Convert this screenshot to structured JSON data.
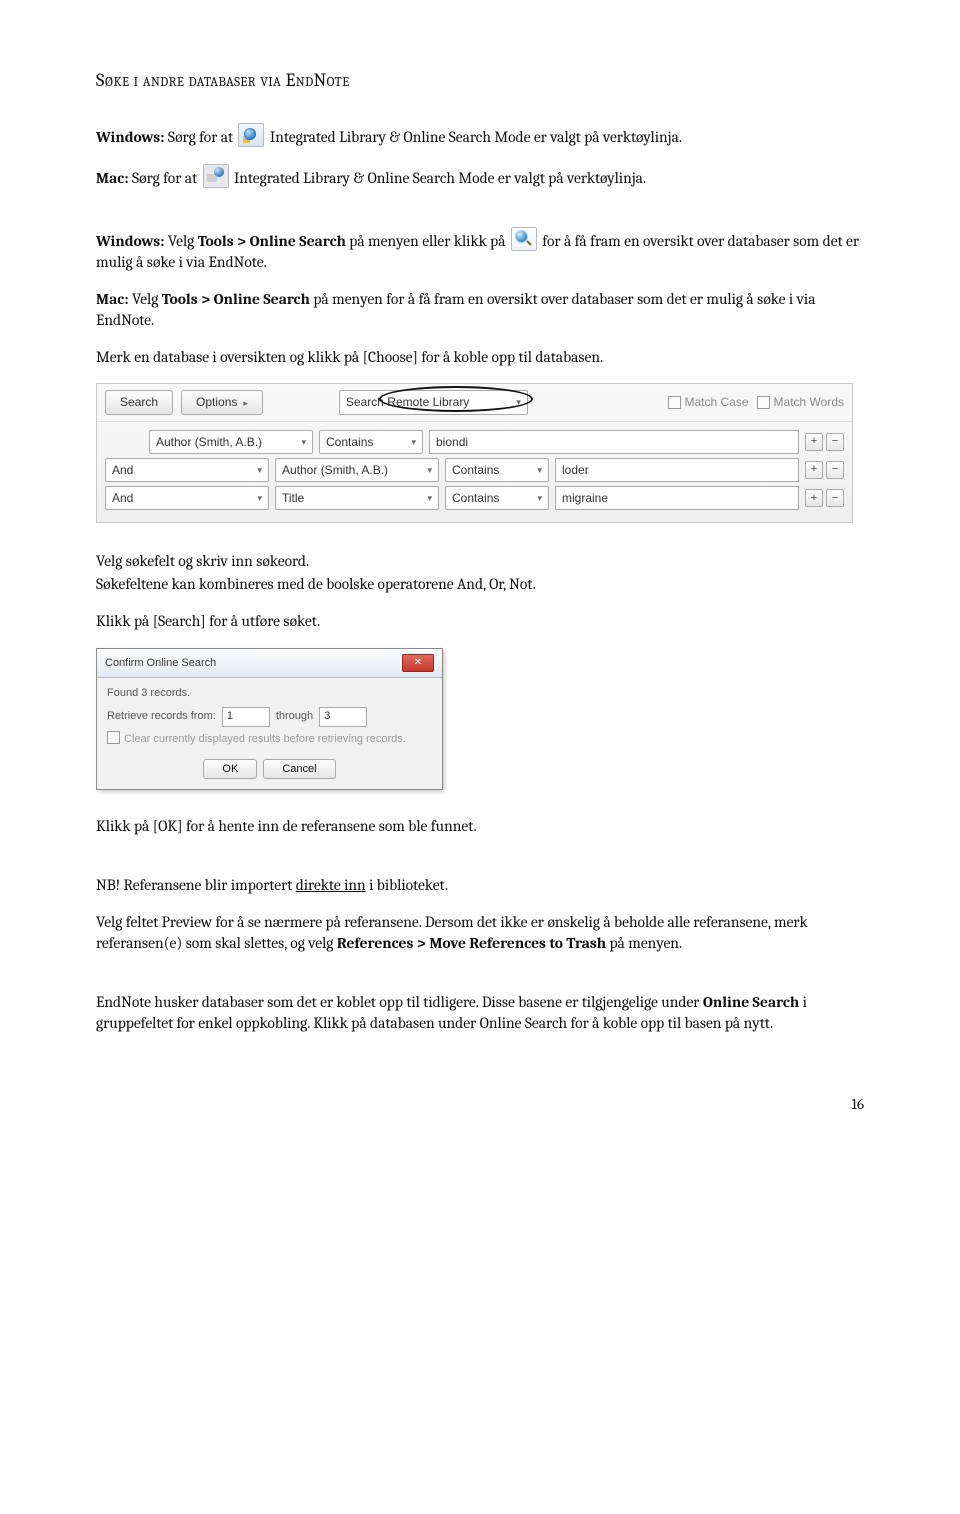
{
  "heading": "Søke i andre databaser via EndNote",
  "p1": {
    "prefix": "Windows:",
    "before": " Sørg for at ",
    "after": " Integrated Library & Online Search Mode er valgt på verktøylinja."
  },
  "p2": {
    "prefix": "Mac:",
    "before": " Sørg for at ",
    "after": " Integrated Library & Online Search Mode er valgt på verktøylinja."
  },
  "p3": {
    "prefix": "Windows:",
    "a": " Velg ",
    "bold": "Tools > Online Search",
    "b": " på menyen eller klikk på ",
    "c": " for å få fram en oversikt over databaser som det er mulig å søke i via EndNote."
  },
  "p4": {
    "prefix": "Mac:",
    "a": " Velg ",
    "bold": "Tools > Online Search",
    "b": " på menyen for å få fram en oversikt over databaser som det er mulig å søke i via EndNote."
  },
  "p5": "Merk en database i oversikten og klikk på [Choose] for å koble opp til databasen.",
  "search_panel": {
    "search_btn": "Search",
    "options_btn": "Options",
    "mode": "Search Remote Library",
    "match_case": "Match Case",
    "match_words": "Match Words",
    "rows": [
      {
        "op": "",
        "field": "Author (Smith, A.B.)",
        "cond": "Contains",
        "value": "biondi"
      },
      {
        "op": "And",
        "field": "Author (Smith, A.B.)",
        "cond": "Contains",
        "value": "loder"
      },
      {
        "op": "And",
        "field": "Title",
        "cond": "Contains",
        "value": "migraine"
      }
    ]
  },
  "p6a": "Velg søkefelt og skriv inn søkeord.",
  "p6b": "Søkefeltene kan kombineres med de boolske operatorene And, Or, Not.",
  "p7": "Klikk på [Search] for å utføre søket.",
  "dialog": {
    "title": "Confirm Online Search",
    "found": "Found 3 records.",
    "retrieve_label": "Retrieve records from:",
    "from": "1",
    "through_label": "through",
    "through": "3",
    "clear_label": "Clear currently displayed results before retrieving records.",
    "ok": "OK",
    "cancel": "Cancel"
  },
  "p8": "Klikk på [OK] for å hente inn de referansene som ble funnet.",
  "p9": {
    "a": "NB! Referansene blir importert ",
    "u": "direkte inn",
    "b": " i biblioteket."
  },
  "p10": {
    "a": "Velg feltet Preview for å se nærmere på referansene. Dersom det ikke er ønskelig å beholde alle referansene, merk referansen(e) som skal slettes, og velg ",
    "bold": "References > Move References to Trash",
    "b": " på menyen."
  },
  "p11": {
    "a": "EndNote husker databaser som det er koblet opp til tidligere. Disse basene er tilgjengelige under ",
    "bold": "Online Search",
    "b": " i gruppefeltet for enkel oppkobling. Klikk på databasen under Online Search for å koble opp til basen på nytt."
  },
  "page_number": "16"
}
